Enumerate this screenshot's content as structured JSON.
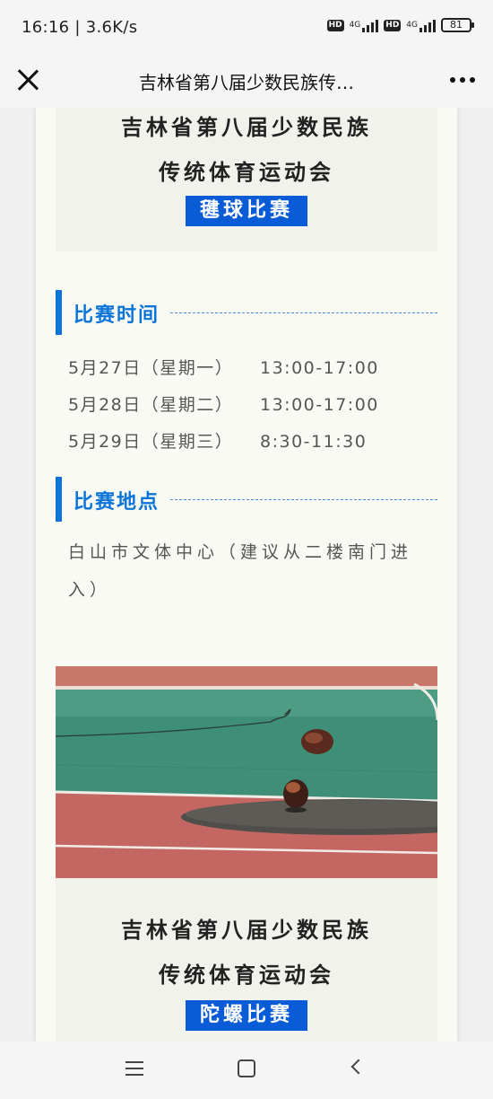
{
  "status_bar": {
    "time": "16:16 | 3.6K/s",
    "hd1": "HD",
    "net1": "4G",
    "hd2": "HD",
    "net2": "4G",
    "battery": "81"
  },
  "nav": {
    "title": "吉林省第八届少数民族传…"
  },
  "card1": {
    "line1": "吉林省第八届少数民族",
    "line2": "传统体育运动会",
    "badge": "毽球比赛"
  },
  "schedule": {
    "heading": "比赛时间",
    "rows": [
      {
        "date": "5月27日（星期一）",
        "time": "13:00-17:00"
      },
      {
        "date": "5月28日（星期二）",
        "time": "13:00-17:00"
      },
      {
        "date": "5月29日（星期三）",
        "time": "8:30-11:30"
      }
    ]
  },
  "venue": {
    "heading": "比赛地点",
    "text": "白山市文体中心（建议从二楼南门进入）"
  },
  "card2": {
    "line1": "吉林省第八届少数民族",
    "line2": "传统体育运动会",
    "badge": "陀螺比赛"
  },
  "colors": {
    "accent_blue": "#0a74d8",
    "badge_blue": "#0a5bd6"
  }
}
